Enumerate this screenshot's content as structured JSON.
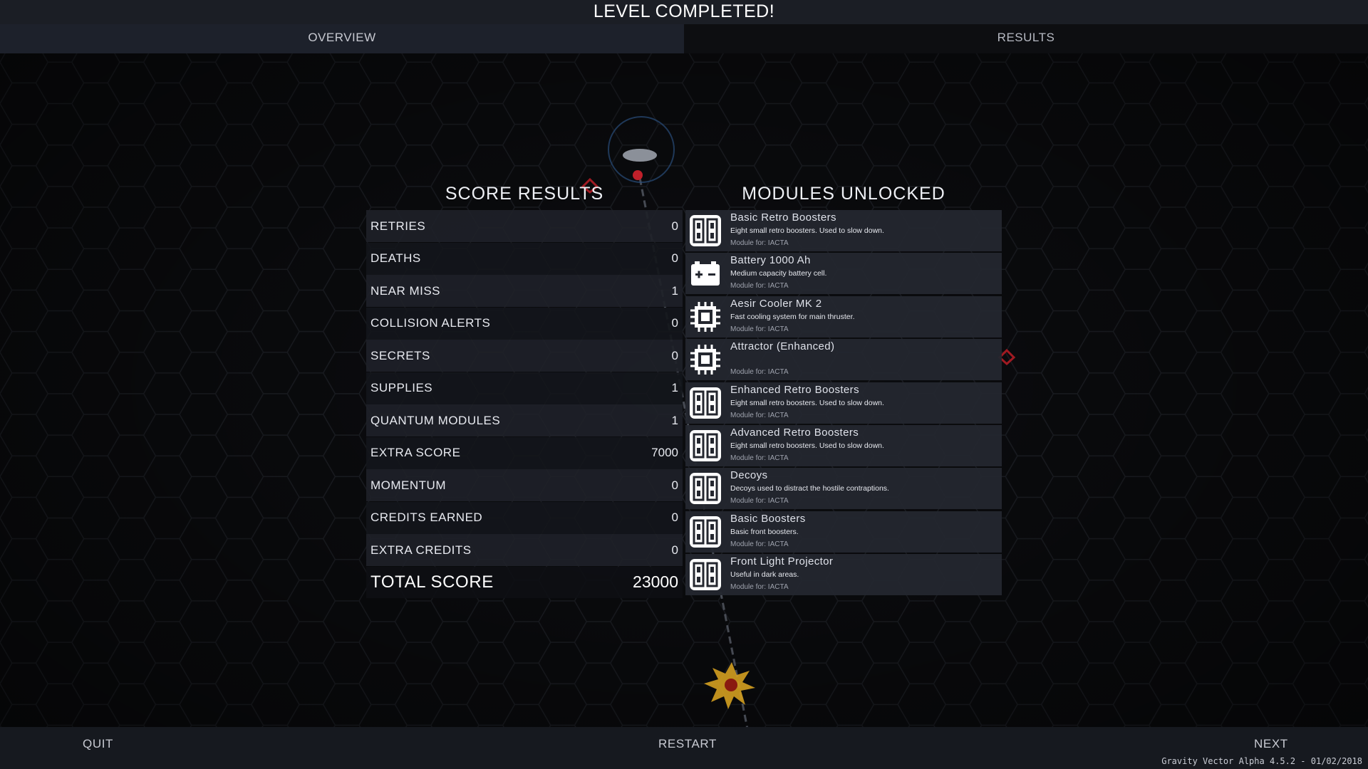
{
  "header": {
    "title": "LEVEL COMPLETED!"
  },
  "tabs": [
    {
      "label": "OVERVIEW",
      "active": true
    },
    {
      "label": "RESULTS",
      "active": false
    }
  ],
  "score": {
    "heading": "SCORE RESULTS",
    "rows": [
      {
        "label": "RETRIES",
        "value": "0"
      },
      {
        "label": "DEATHS",
        "value": "0"
      },
      {
        "label": "NEAR MISS",
        "value": "1"
      },
      {
        "label": "COLLISION ALERTS",
        "value": "0"
      },
      {
        "label": "SECRETS",
        "value": "0"
      },
      {
        "label": "SUPPLIES",
        "value": "1"
      },
      {
        "label": "QUANTUM MODULES",
        "value": "1"
      },
      {
        "label": "EXTRA SCORE",
        "value": "7000"
      },
      {
        "label": "MOMENTUM",
        "value": "0"
      },
      {
        "label": "CREDITS EARNED",
        "value": "0"
      },
      {
        "label": "EXTRA CREDITS",
        "value": "0"
      }
    ],
    "total_label": "TOTAL SCORE",
    "total_value": "23000"
  },
  "modules": {
    "heading": "MODULES UNLOCKED",
    "items": [
      {
        "name": "Basic Retro Boosters",
        "desc": "Eight small retro boosters. Used to slow down.",
        "for": "Module for: IACTA",
        "icon": "booster-icon"
      },
      {
        "name": "Battery 1000 Ah",
        "desc": "Medium capacity battery cell.",
        "for": "Module for: IACTA",
        "icon": "battery-icon"
      },
      {
        "name": "Aesir Cooler MK 2",
        "desc": "Fast cooling system for main thruster.",
        "for": "Module for: IACTA",
        "icon": "chip-icon"
      },
      {
        "name": "Attractor (Enhanced)",
        "desc": "",
        "for": "Module for: IACTA",
        "icon": "chip-icon"
      },
      {
        "name": "Enhanced Retro Boosters",
        "desc": "Eight small retro boosters. Used to slow down.",
        "for": "Module for: IACTA",
        "icon": "booster-icon"
      },
      {
        "name": "Advanced Retro Boosters",
        "desc": "Eight small retro boosters. Used to slow down.",
        "for": "Module for: IACTA",
        "icon": "booster-icon"
      },
      {
        "name": "Decoys",
        "desc": "Decoys used to distract the hostile contraptions.",
        "for": "Module for: IACTA",
        "icon": "booster-icon"
      },
      {
        "name": "Basic Boosters",
        "desc": "Basic front boosters.",
        "for": "Module for: IACTA",
        "icon": "booster-icon"
      },
      {
        "name": "Front Light Projector",
        "desc": "Useful in dark areas.",
        "for": "Module for: IACTA",
        "icon": "booster-icon"
      }
    ]
  },
  "footer": {
    "quit": "QUIT",
    "restart": "RESTART",
    "next": "NEXT",
    "version": "Gravity Vector Alpha 4.5.2 - 01/02/2018"
  }
}
